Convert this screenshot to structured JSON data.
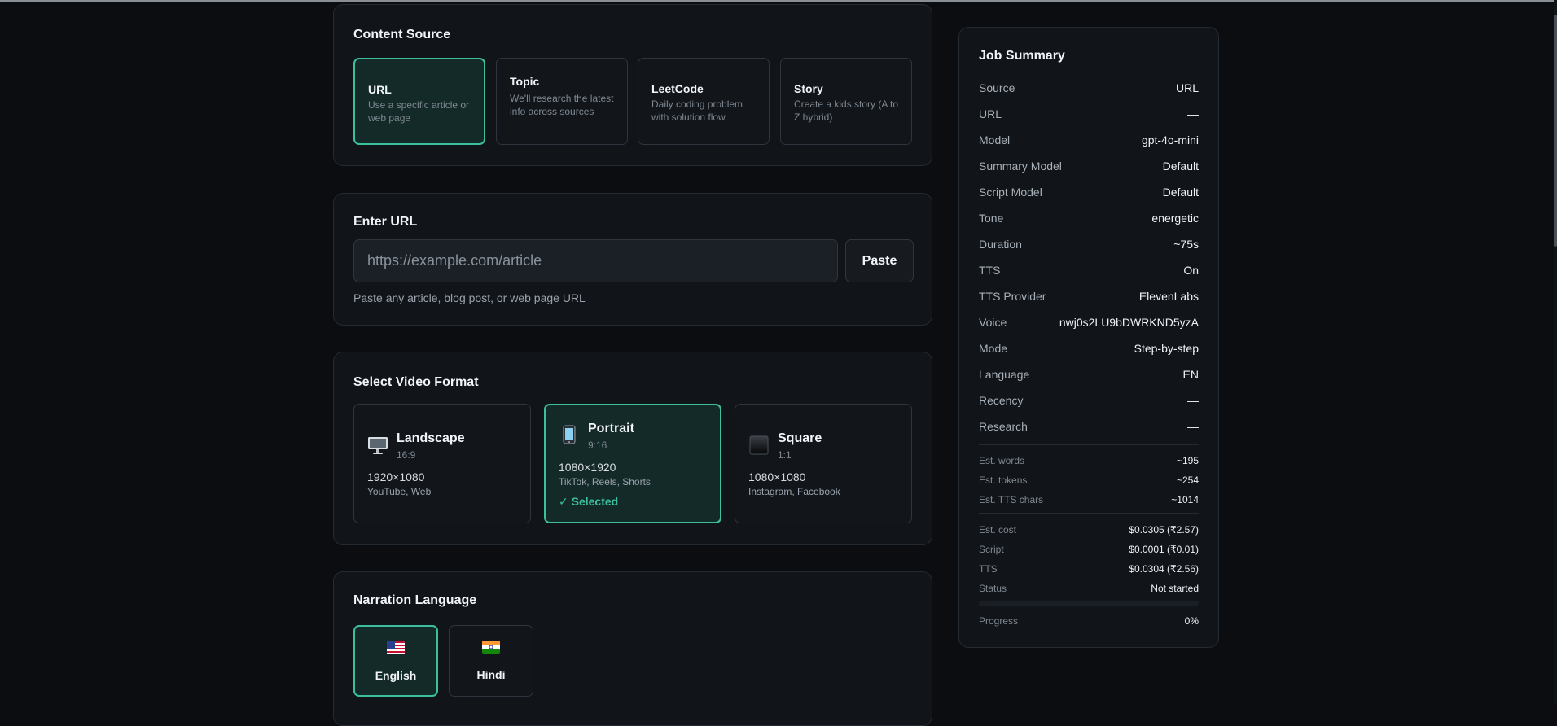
{
  "content_source": {
    "title": "Content Source",
    "options": [
      {
        "title": "URL",
        "desc": "Use a specific article or web page",
        "selected": true
      },
      {
        "title": "Topic",
        "desc": "We'll research the latest info across sources",
        "selected": false
      },
      {
        "title": "LeetCode",
        "desc": "Daily coding problem with solution flow",
        "selected": false
      },
      {
        "title": "Story",
        "desc": "Create a kids story (A to Z hybrid)",
        "selected": false
      }
    ]
  },
  "enter_url": {
    "title": "Enter URL",
    "placeholder": "https://example.com/article",
    "value": "",
    "paste_label": "Paste",
    "hint": "Paste any article, blog post, or web page URL"
  },
  "video_format": {
    "title": "Select Video Format",
    "options": [
      {
        "name": "Landscape",
        "ratio": "16:9",
        "resolution": "1920×1080",
        "platforms": "YouTube, Web",
        "icon": "monitor-icon",
        "selected": false
      },
      {
        "name": "Portrait",
        "ratio": "9:16",
        "resolution": "1080×1920",
        "platforms": "TikTok, Reels, Shorts",
        "icon": "phone-icon",
        "selected": true
      },
      {
        "name": "Square",
        "ratio": "1:1",
        "resolution": "1080×1080",
        "platforms": "Instagram, Facebook",
        "icon": "square-icon",
        "selected": false
      }
    ],
    "selected_label": "✓ Selected"
  },
  "narration_language": {
    "title": "Narration Language",
    "options": [
      {
        "label": "English",
        "flag": "us-flag-icon",
        "selected": true
      },
      {
        "label": "Hindi",
        "flag": "india-flag-icon",
        "selected": false
      }
    ]
  },
  "job_summary": {
    "title": "Job Summary",
    "rows": [
      {
        "key": "Source",
        "value": "URL"
      },
      {
        "key": "URL",
        "value": "—"
      },
      {
        "key": "Model",
        "value": "gpt-4o-mini"
      },
      {
        "key": "Summary Model",
        "value": "Default"
      },
      {
        "key": "Script Model",
        "value": "Default"
      },
      {
        "key": "Tone",
        "value": "energetic"
      },
      {
        "key": "Duration",
        "value": "~75s"
      },
      {
        "key": "TTS",
        "value": "On"
      },
      {
        "key": "TTS Provider",
        "value": "ElevenLabs"
      },
      {
        "key": "Voice",
        "value": "nwj0s2LU9bDWRKND5yzA"
      },
      {
        "key": "Mode",
        "value": "Step-by-step"
      },
      {
        "key": "Language",
        "value": "EN"
      },
      {
        "key": "Recency",
        "value": "—"
      },
      {
        "key": "Research",
        "value": "—"
      }
    ],
    "estimates": [
      {
        "key": "Est. words",
        "value": "~195"
      },
      {
        "key": "Est. tokens",
        "value": "~254"
      },
      {
        "key": "Est. TTS chars",
        "value": "~1014"
      }
    ],
    "costs": [
      {
        "key": "Est. cost",
        "value": "$0.0305 (₹2.57)"
      },
      {
        "key": "Script",
        "value": "$0.0001 (₹0.01)"
      },
      {
        "key": "TTS",
        "value": "$0.0304 (₹2.56)"
      },
      {
        "key": "Status",
        "value": "Not started"
      }
    ],
    "progress": {
      "label": "Progress",
      "value": "0%",
      "fraction": 0
    }
  },
  "colors": {
    "accent": "#3bbf9e",
    "background": "#0b0d10",
    "card": "#111418"
  }
}
